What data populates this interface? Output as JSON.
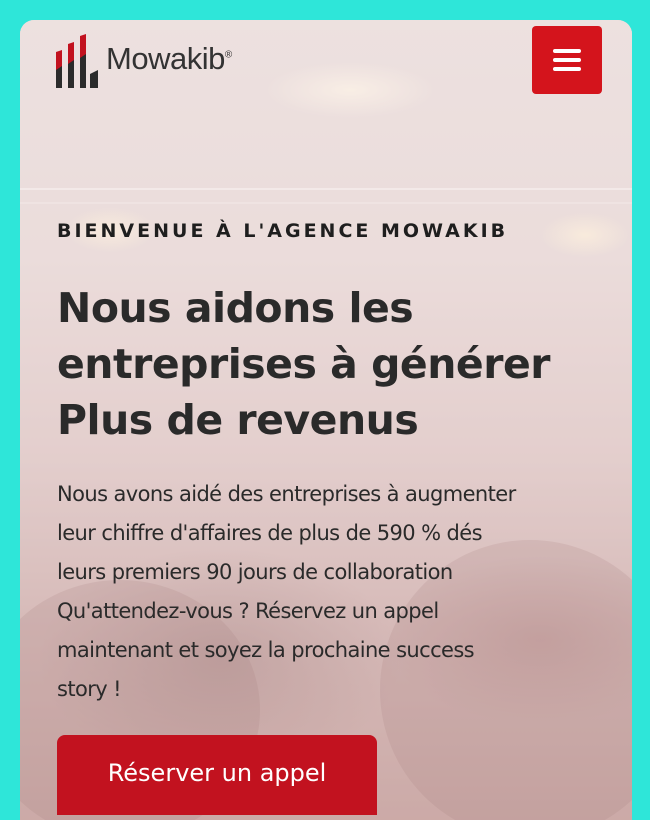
{
  "header": {
    "brand_name": "Mowakib",
    "brand_trademark": "®",
    "menu_icon": "hamburger-menu-icon"
  },
  "hero": {
    "eyebrow": "BIENVENUE À L'AGENCE MOWAKIB",
    "headline_lines": [
      "Nous aidons les",
      "entreprises à générer",
      "Plus de revenus"
    ],
    "body_lines": [
      "Nous avons aidé des entreprises à augmenter",
      "leur chiffre d'affaires de plus de 590 % dés",
      "leurs premiers 90 jours de collaboration",
      "Qu'attendez-vous ? Réservez un appel",
      "maintenant et soyez la prochaine success",
      "story !"
    ],
    "cta_label": "Réserver un appel"
  },
  "colors": {
    "page_background": "#2ee6d9",
    "brand_red": "#d4141c",
    "cta_red": "#c2121f",
    "text_dark": "#2a2a2a"
  }
}
